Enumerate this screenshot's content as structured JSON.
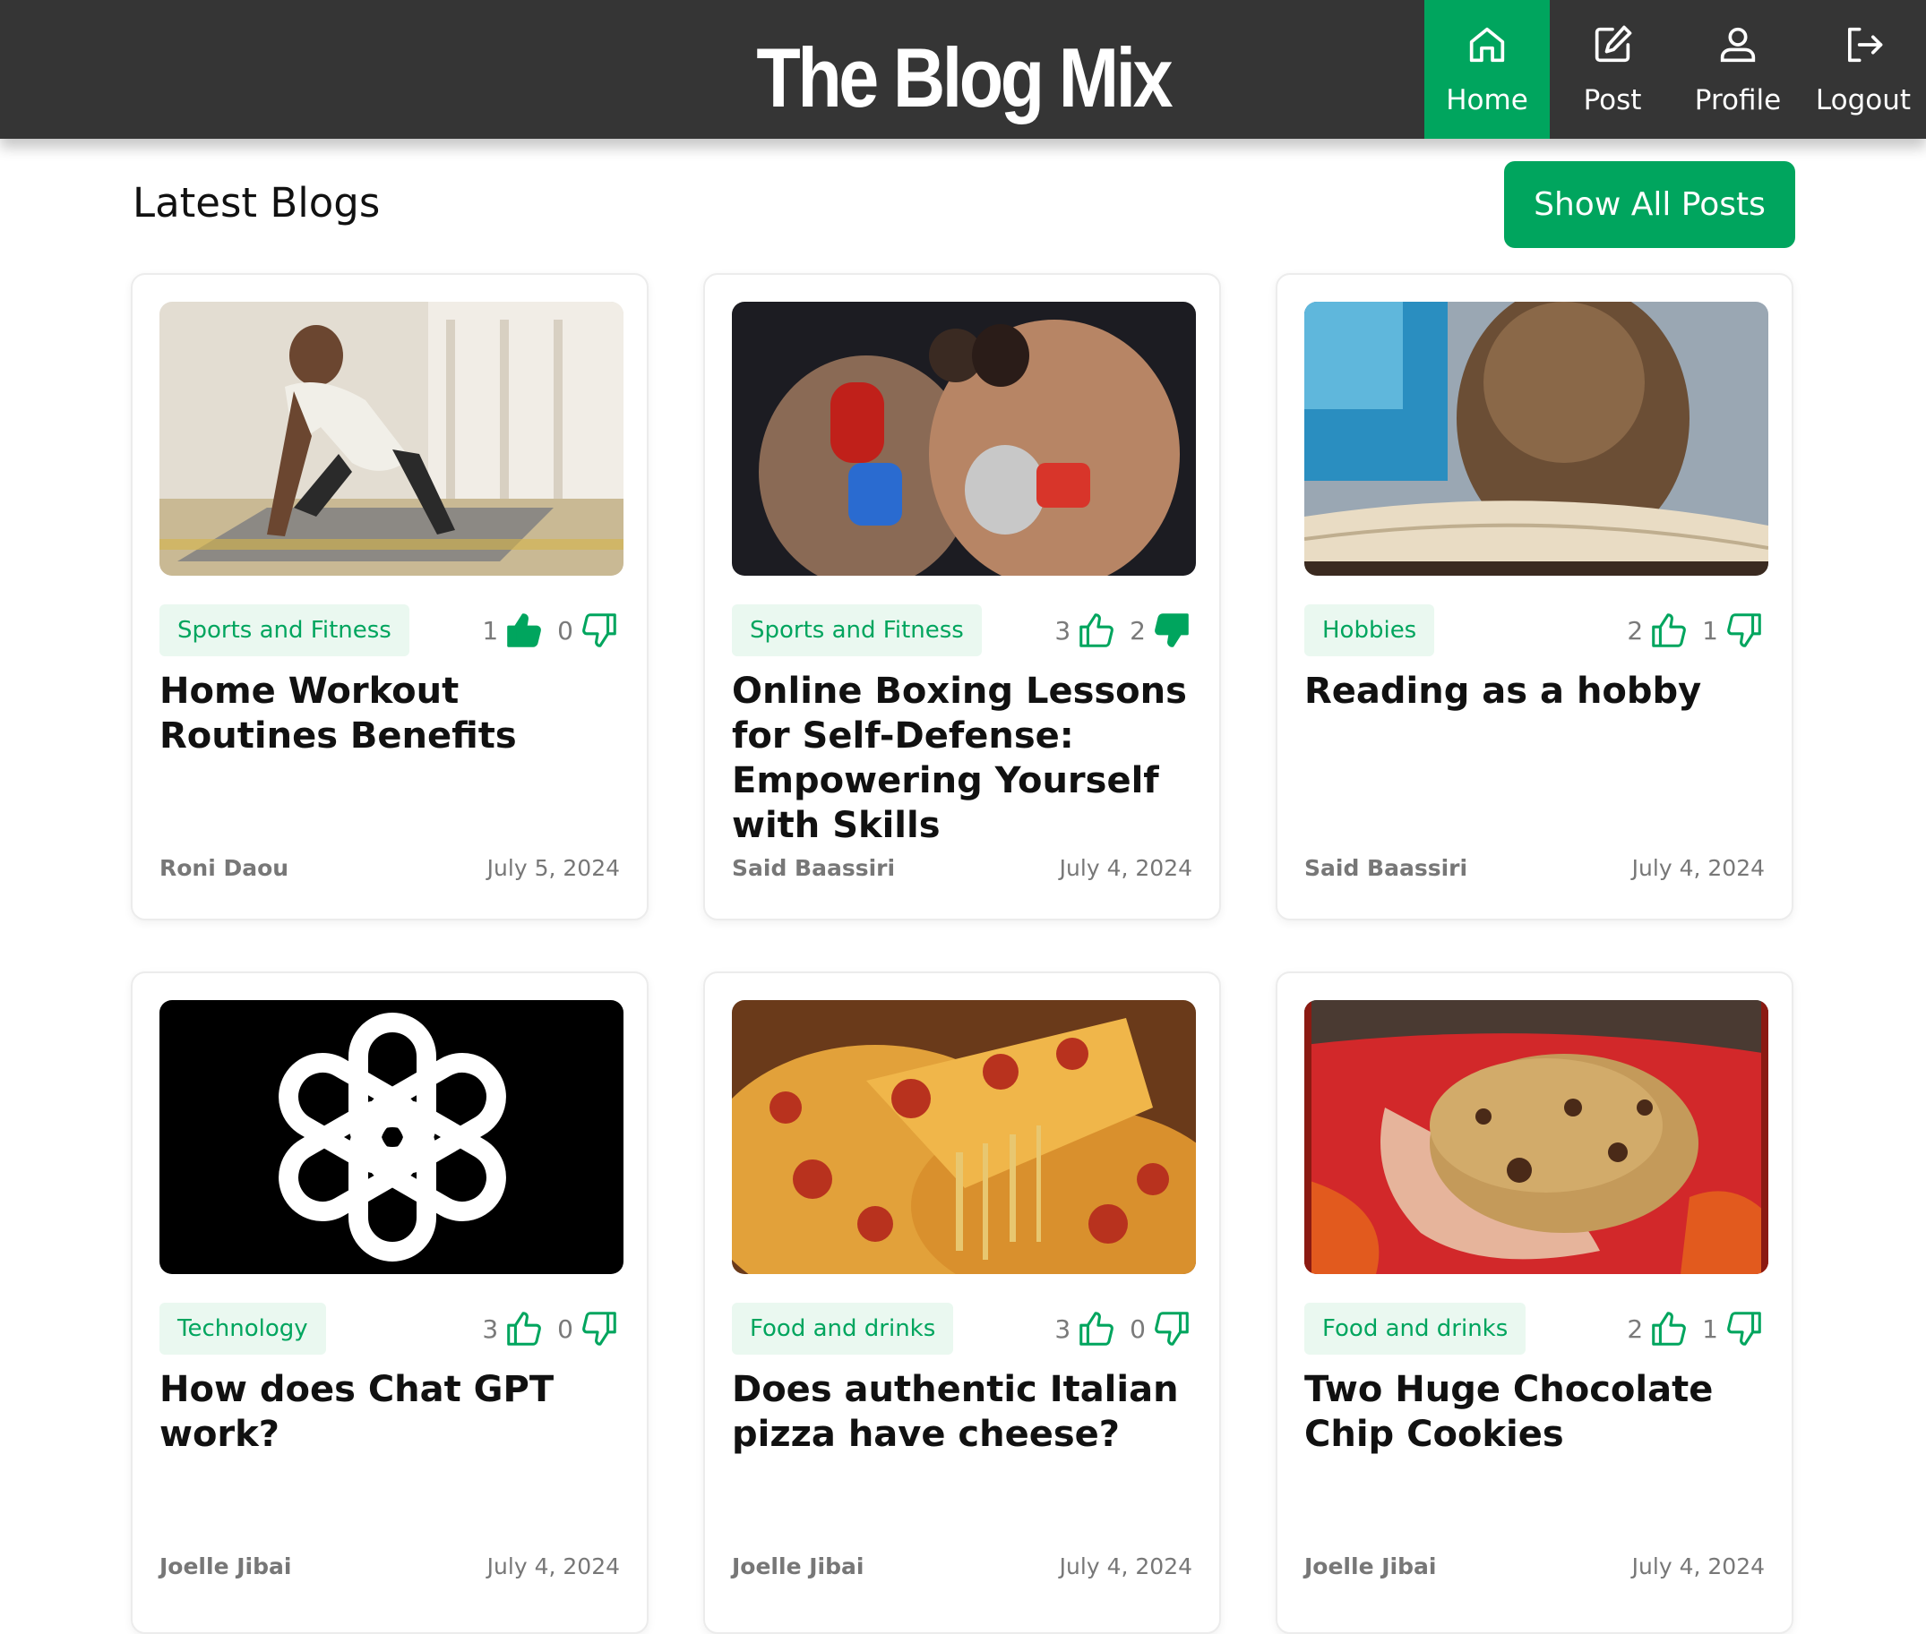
{
  "header": {
    "brand": "The Blog Mix",
    "nav": [
      {
        "label": "Home",
        "icon": "home-icon",
        "active": true
      },
      {
        "label": "Post",
        "icon": "edit-icon",
        "active": false
      },
      {
        "label": "Profile",
        "icon": "user-icon",
        "active": false
      },
      {
        "label": "Logout",
        "icon": "logout-icon",
        "active": false
      }
    ]
  },
  "main": {
    "section_title": "Latest Blogs",
    "show_all_label": "Show All Posts",
    "posts": [
      {
        "category": "Sports and Fitness",
        "likes": "1",
        "dislikes": "0",
        "liked": true,
        "disliked": false,
        "title": "Home Workout Routines Benefits",
        "author": "Roni Daou",
        "date": "July 5, 2024",
        "image": "man doing workout plank on yoga mat"
      },
      {
        "category": "Sports and Fitness",
        "likes": "3",
        "dislikes": "2",
        "liked": false,
        "disliked": true,
        "title": "Online Boxing Lessons for Self-Defense: Empowering Yourself with Skills",
        "author": "Said Baassiri",
        "date": "July 4, 2024",
        "image": "two boxers fighting"
      },
      {
        "category": "Hobbies",
        "likes": "2",
        "dislikes": "1",
        "liked": false,
        "disliked": false,
        "title": "Reading as a hobby",
        "author": "Said Baassiri",
        "date": "July 4, 2024",
        "image": "child head resting on open book"
      },
      {
        "category": "Technology",
        "likes": "3",
        "dislikes": "0",
        "liked": false,
        "disliked": false,
        "title": "How does Chat GPT work?",
        "author": "Joelle Jibai",
        "date": "July 4, 2024",
        "image": "openai logo"
      },
      {
        "category": "Food and drinks",
        "likes": "3",
        "dislikes": "0",
        "liked": false,
        "disliked": false,
        "title": "Does authentic Italian pizza have cheese?",
        "author": "Joelle Jibai",
        "date": "July 4, 2024",
        "image": "pepperoni pizza slice cheese pull"
      },
      {
        "category": "Food and drinks",
        "likes": "2",
        "dislikes": "1",
        "liked": false,
        "disliked": false,
        "title": "Two Huge Chocolate Chip Cookies",
        "author": "Joelle Jibai",
        "date": "July 4, 2024",
        "image": "hand holding chocolate chip cookie"
      }
    ]
  },
  "colors": {
    "accent": "#00a55e",
    "header_bg": "#353535",
    "tag_bg": "#eaf8f0"
  }
}
